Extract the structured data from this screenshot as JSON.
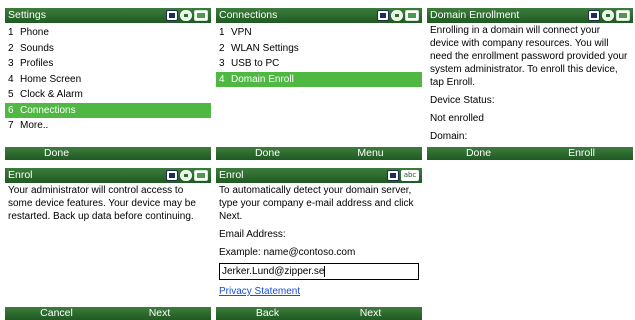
{
  "screens": {
    "settings": {
      "title": "Settings",
      "items": [
        {
          "num": "1",
          "label": "Phone"
        },
        {
          "num": "2",
          "label": "Sounds"
        },
        {
          "num": "3",
          "label": "Profiles"
        },
        {
          "num": "4",
          "label": "Home Screen"
        },
        {
          "num": "5",
          "label": "Clock & Alarm"
        },
        {
          "num": "6",
          "label": "Connections"
        },
        {
          "num": "7",
          "label": "More.."
        }
      ],
      "selected_index": 5,
      "softkey_left": "Done",
      "softkey_right": ""
    },
    "connections": {
      "title": "Connections",
      "items": [
        {
          "num": "1",
          "label": "VPN"
        },
        {
          "num": "2",
          "label": "WLAN Settings"
        },
        {
          "num": "3",
          "label": "USB to PC"
        },
        {
          "num": "4",
          "label": "Domain Enroll"
        }
      ],
      "selected_index": 3,
      "softkey_left": "Done",
      "softkey_right": "Menu"
    },
    "domain_enrollment": {
      "title": "Domain Enrollment",
      "body": "Enrolling in a domain will connect your device with company resources. You will need the enrollment password provided your system administrator. To enroll this device, tap Enroll.",
      "status_label": "Device Status:",
      "status_value": "Not enrolled",
      "domain_label": "Domain:",
      "softkey_left": "Done",
      "softkey_right": "Enroll"
    },
    "enrol": {
      "title": "Enrol",
      "body": "Your administrator will control access to some device features. Your device may be restarted. Back up data before continuing.",
      "softkey_left": "Cancel",
      "softkey_right": "Next"
    },
    "enrol_email": {
      "title": "Enrol",
      "input_mode": "abc",
      "body": "To automatically detect your domain server, type your company e-mail address and click Next.",
      "email_label": "Email Address:",
      "example": "Example: name@contoso.com",
      "email_value": "Jerker.Lund@zipper.se",
      "privacy_link": "Privacy Statement",
      "softkey_left": "Back",
      "softkey_right": "Next"
    }
  },
  "status_icons": [
    "signal-icon",
    "connectivity-icon",
    "battery-icon"
  ],
  "colors": {
    "titlebar": "#2e6b2f",
    "selection": "#4fb843",
    "link": "#1a4fd6"
  }
}
